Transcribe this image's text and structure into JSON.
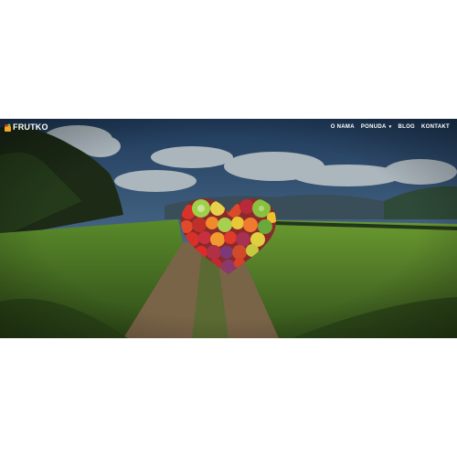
{
  "brand": {
    "name": "FRUTKO",
    "logo_icon": "fruit-basket-icon",
    "accent": "#f5a623"
  },
  "nav": {
    "items": [
      {
        "label": "O NAMA",
        "has_dropdown": false
      },
      {
        "label": "PONUDA",
        "has_dropdown": true
      },
      {
        "label": "BLOG",
        "has_dropdown": false
      },
      {
        "label": "KONTAKT",
        "has_dropdown": false
      }
    ],
    "dropdown_icon": "caret-down-icon"
  },
  "hero": {
    "image": "countryside-road-landscape",
    "centerpiece": "fruit-heart-image",
    "colors": {
      "sky": "#2d4a68",
      "field": "#4f7a2a",
      "road": "#8a7355"
    }
  }
}
